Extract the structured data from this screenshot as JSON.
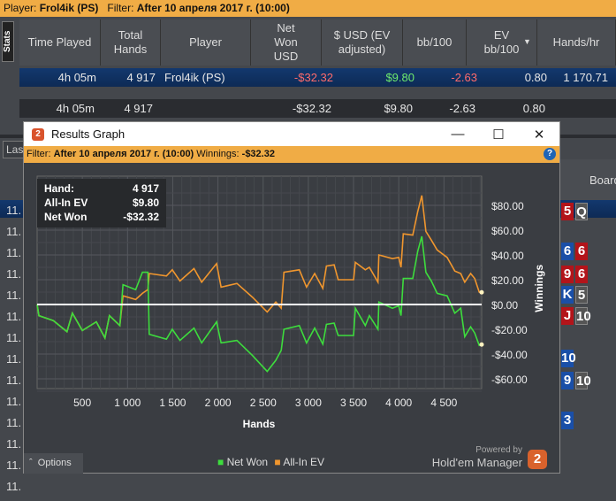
{
  "topbar": {
    "player_label": "Player:",
    "player": "Frol4ik (PS)",
    "filter_label": "Filter:",
    "filter": "After 10 апреля 2017 г. (10:00)"
  },
  "stats_tab": "Stats",
  "columns": [
    "Time Played",
    "Total Hands",
    "Player",
    "Net Won USD",
    "$ USD (EV adjusted)",
    "bb/100",
    "EV bb/100",
    "Hands/hr"
  ],
  "selected_row": {
    "time": "4h 05m",
    "hands": "4 917",
    "player": "Frol4ik (PS)",
    "net_won": "-$32.32",
    "ev_usd": "$9.80",
    "bb100": "-2.63",
    "ev_bb100": "0.80",
    "hands_hr": "1 170.71"
  },
  "total_row": {
    "time": "4h 05m",
    "hands": "4 917",
    "net_won": "-$32.32",
    "ev_usd": "$9.80",
    "bb100": "-2.63",
    "ev_bb100": "0.80"
  },
  "left_cut_label": "Las",
  "left_rows": [
    "11.",
    "11.",
    "11.",
    "11.",
    "11.",
    "11.",
    "11.",
    "11.",
    "11.",
    "11.",
    "11.",
    "11.",
    "11.",
    "11."
  ],
  "board_header": "Board",
  "cards": [
    [
      "5",
      "r"
    ],
    [
      "Q",
      "g"
    ],
    [
      "6",
      "b"
    ],
    [
      "6",
      "r"
    ],
    [
      "9",
      "r"
    ],
    [
      "6",
      "r"
    ],
    [
      "K",
      "b"
    ],
    [
      "5",
      "g"
    ],
    [
      "J",
      "r"
    ],
    [
      "10",
      "g"
    ],
    [
      "10",
      "b"
    ],
    [
      "9",
      "b"
    ],
    [
      "10",
      "g"
    ],
    [
      "3",
      "b"
    ]
  ],
  "window": {
    "title": "Results Graph",
    "logo": "2",
    "filter_label": "Filter:",
    "filter": "After 10 апреля 2017 г. (10:00)",
    "winnings_label": "Winnings:",
    "winnings": "-$32.32",
    "options": "Options",
    "powered_by": "Powered by",
    "brand": "Hold'em Manager"
  },
  "tooltip": {
    "hand_label": "Hand:",
    "hand": "4 917",
    "ev_label": "All-In EV",
    "ev": "$9.80",
    "net_label": "Net Won",
    "net": "-$32.32"
  },
  "chart_data": {
    "type": "line",
    "xlabel": "Hands",
    "ylabel": "Winnings",
    "xlim": [
      0,
      4917
    ],
    "ylim": [
      -70,
      95
    ],
    "x_ticks": [
      500,
      1000,
      1500,
      2000,
      2500,
      3000,
      3500,
      4000,
      4500
    ],
    "x_tick_labels": [
      "500",
      "1 000",
      "1 500",
      "2 000",
      "2 500",
      "3 000",
      "3 500",
      "4 000",
      "4 500"
    ],
    "y_ticks": [
      80,
      60,
      40,
      20,
      0,
      -20,
      -40,
      -60
    ],
    "y_tick_labels": [
      "$80.00",
      "$60.00",
      "$40.00",
      "$20.00",
      "$0.00",
      "-$20.00",
      "-$40.00",
      "-$60.00"
    ],
    "grid": true,
    "legend": "bottom",
    "series": [
      {
        "name": "Net Won",
        "color": "#3ddc3d",
        "points": [
          [
            0,
            0
          ],
          [
            20,
            -9
          ],
          [
            180,
            -13
          ],
          [
            330,
            -22
          ],
          [
            390,
            -7
          ],
          [
            500,
            -21
          ],
          [
            655,
            -14
          ],
          [
            750,
            -27
          ],
          [
            800,
            -9
          ],
          [
            915,
            -17
          ],
          [
            950,
            16
          ],
          [
            1090,
            12
          ],
          [
            1165,
            26
          ],
          [
            1225,
            26
          ],
          [
            1240,
            -24
          ],
          [
            1430,
            -28
          ],
          [
            1495,
            -20
          ],
          [
            1580,
            -29
          ],
          [
            1735,
            -19
          ],
          [
            1820,
            -31
          ],
          [
            1985,
            -14
          ],
          [
            2035,
            -31
          ],
          [
            2210,
            -29
          ],
          [
            2380,
            -41
          ],
          [
            2545,
            -54
          ],
          [
            2640,
            -45
          ],
          [
            2700,
            -37
          ],
          [
            2730,
            -20
          ],
          [
            2900,
            -17
          ],
          [
            2980,
            -31
          ],
          [
            3070,
            -19
          ],
          [
            3160,
            -32
          ],
          [
            3200,
            -16
          ],
          [
            3285,
            -15
          ],
          [
            3330,
            -25
          ],
          [
            3500,
            -25
          ],
          [
            3520,
            -3
          ],
          [
            3630,
            -17
          ],
          [
            3675,
            -9
          ],
          [
            3770,
            -20
          ],
          [
            3780,
            2
          ],
          [
            3930,
            -3
          ],
          [
            4000,
            -1
          ],
          [
            4025,
            -9
          ],
          [
            4050,
            21
          ],
          [
            4155,
            21
          ],
          [
            4210,
            43
          ],
          [
            4255,
            55
          ],
          [
            4300,
            26
          ],
          [
            4360,
            19
          ],
          [
            4425,
            9
          ],
          [
            4535,
            7
          ],
          [
            4620,
            -7
          ],
          [
            4685,
            -3
          ],
          [
            4730,
            -26
          ],
          [
            4795,
            -18
          ],
          [
            4840,
            -23
          ],
          [
            4890,
            -33
          ],
          [
            4917,
            -32.32
          ]
        ]
      },
      {
        "name": "All-In EV",
        "color": "#f0962e",
        "points": [
          [
            0,
            0
          ],
          [
            20,
            -9
          ],
          [
            180,
            -13
          ],
          [
            330,
            -22
          ],
          [
            390,
            -7
          ],
          [
            500,
            -21
          ],
          [
            655,
            -14
          ],
          [
            750,
            -27
          ],
          [
            800,
            -9
          ],
          [
            915,
            -17
          ],
          [
            950,
            7
          ],
          [
            1090,
            4
          ],
          [
            1165,
            9
          ],
          [
            1225,
            12
          ],
          [
            1240,
            25
          ],
          [
            1430,
            23
          ],
          [
            1495,
            28
          ],
          [
            1580,
            19
          ],
          [
            1735,
            29
          ],
          [
            1820,
            18
          ],
          [
            1985,
            33
          ],
          [
            2035,
            14
          ],
          [
            2210,
            17
          ],
          [
            2380,
            6
          ],
          [
            2545,
            -6
          ],
          [
            2640,
            2
          ],
          [
            2700,
            -3
          ],
          [
            2730,
            26
          ],
          [
            2900,
            28
          ],
          [
            2980,
            14
          ],
          [
            3070,
            25
          ],
          [
            3160,
            13
          ],
          [
            3200,
            31
          ],
          [
            3285,
            32
          ],
          [
            3330,
            20
          ],
          [
            3500,
            20
          ],
          [
            3520,
            34
          ],
          [
            3630,
            28
          ],
          [
            3675,
            30
          ],
          [
            3770,
            18
          ],
          [
            3780,
            40
          ],
          [
            3930,
            37
          ],
          [
            4000,
            38
          ],
          [
            4025,
            30
          ],
          [
            4050,
            57
          ],
          [
            4155,
            56
          ],
          [
            4210,
            75
          ],
          [
            4255,
            88
          ],
          [
            4300,
            59
          ],
          [
            4360,
            52
          ],
          [
            4425,
            44
          ],
          [
            4535,
            38
          ],
          [
            4620,
            27
          ],
          [
            4685,
            25
          ],
          [
            4730,
            18
          ],
          [
            4795,
            25
          ],
          [
            4840,
            21
          ],
          [
            4890,
            10
          ],
          [
            4917,
            9.8
          ]
        ]
      }
    ]
  }
}
